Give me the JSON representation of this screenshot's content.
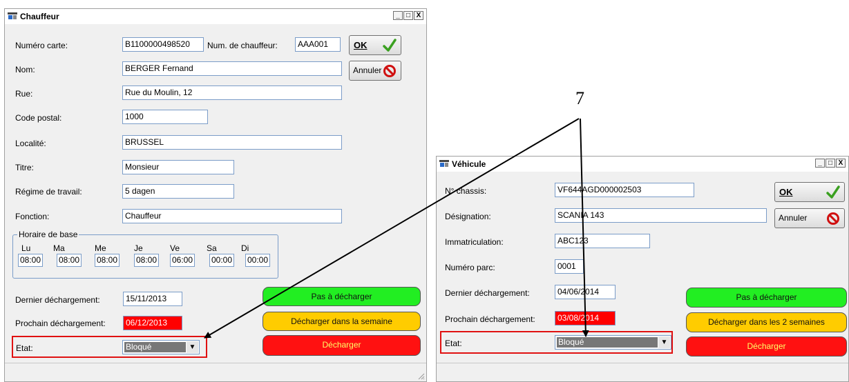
{
  "chauffeur": {
    "title": "Chauffeur",
    "controls": [
      "_",
      "□",
      "X"
    ],
    "labels": {
      "numero_carte": "Numéro carte:",
      "num_chauffeur": "Num. de chauffeur:",
      "nom": "Nom:",
      "rue": "Rue:",
      "code_postal": "Code postal:",
      "localite": "Localité:",
      "titre": "Titre:",
      "regime": "Régime de travail:",
      "fonction": "Fonction:",
      "dernier": "Dernier déchargement:",
      "prochain": "Prochain déchargement:",
      "etat": "Etat:"
    },
    "values": {
      "numero_carte": "B1100000498520",
      "num_chauffeur": "AAA001",
      "nom": "BERGER Fernand",
      "rue": "Rue du Moulin, 12",
      "code_postal": "1000",
      "localite": "BRUSSEL",
      "titre": "Monsieur",
      "regime": "5 dagen",
      "fonction": "Chauffeur",
      "dernier": "15/11/2013",
      "prochain": "06/12/2013",
      "etat": "Bloqué"
    },
    "horaire": {
      "title": "Horaire de base",
      "days": [
        {
          "label": "Lu",
          "time": "08:00"
        },
        {
          "label": "Ma",
          "time": "08:00"
        },
        {
          "label": "Me",
          "time": "08:00"
        },
        {
          "label": "Je",
          "time": "08:00"
        },
        {
          "label": "Ve",
          "time": "06:00"
        },
        {
          "label": "Sa",
          "time": "00:00"
        },
        {
          "label": "Di",
          "time": "00:00"
        }
      ]
    },
    "buttons": {
      "ok": "OK",
      "annuler": "Annuler",
      "pas": "Pas à décharger",
      "semaine": "Décharger dans la semaine",
      "decharger": "Décharger"
    }
  },
  "vehicule": {
    "title": "Véhicule",
    "controls": [
      "_",
      "□",
      "X"
    ],
    "labels": {
      "chassis": "N° chassis:",
      "designation": "Désignation:",
      "immatriculation": "Immatriculation:",
      "numero_parc": "Numéro parc:",
      "dernier": "Dernier déchargement:",
      "prochain": "Prochain déchargement:",
      "etat": "Etat:"
    },
    "values": {
      "chassis": "VF644AGD000002503",
      "designation": "SCANIA 143",
      "immatriculation": "ABC123",
      "numero_parc": "0001",
      "dernier": "04/06/2014",
      "prochain": "03/08/2014",
      "etat": "Bloqué"
    },
    "buttons": {
      "ok": "OK",
      "annuler": "Annuler",
      "pas": "Pas à décharger",
      "deux_semaines": "Décharger dans les 2 semaines",
      "decharger": "Décharger"
    }
  },
  "annotation": {
    "label": "7"
  },
  "colors": {
    "green": "#22ee22",
    "yellow": "#ffcc00",
    "red": "#ff1111",
    "highlight": "#e01010"
  }
}
